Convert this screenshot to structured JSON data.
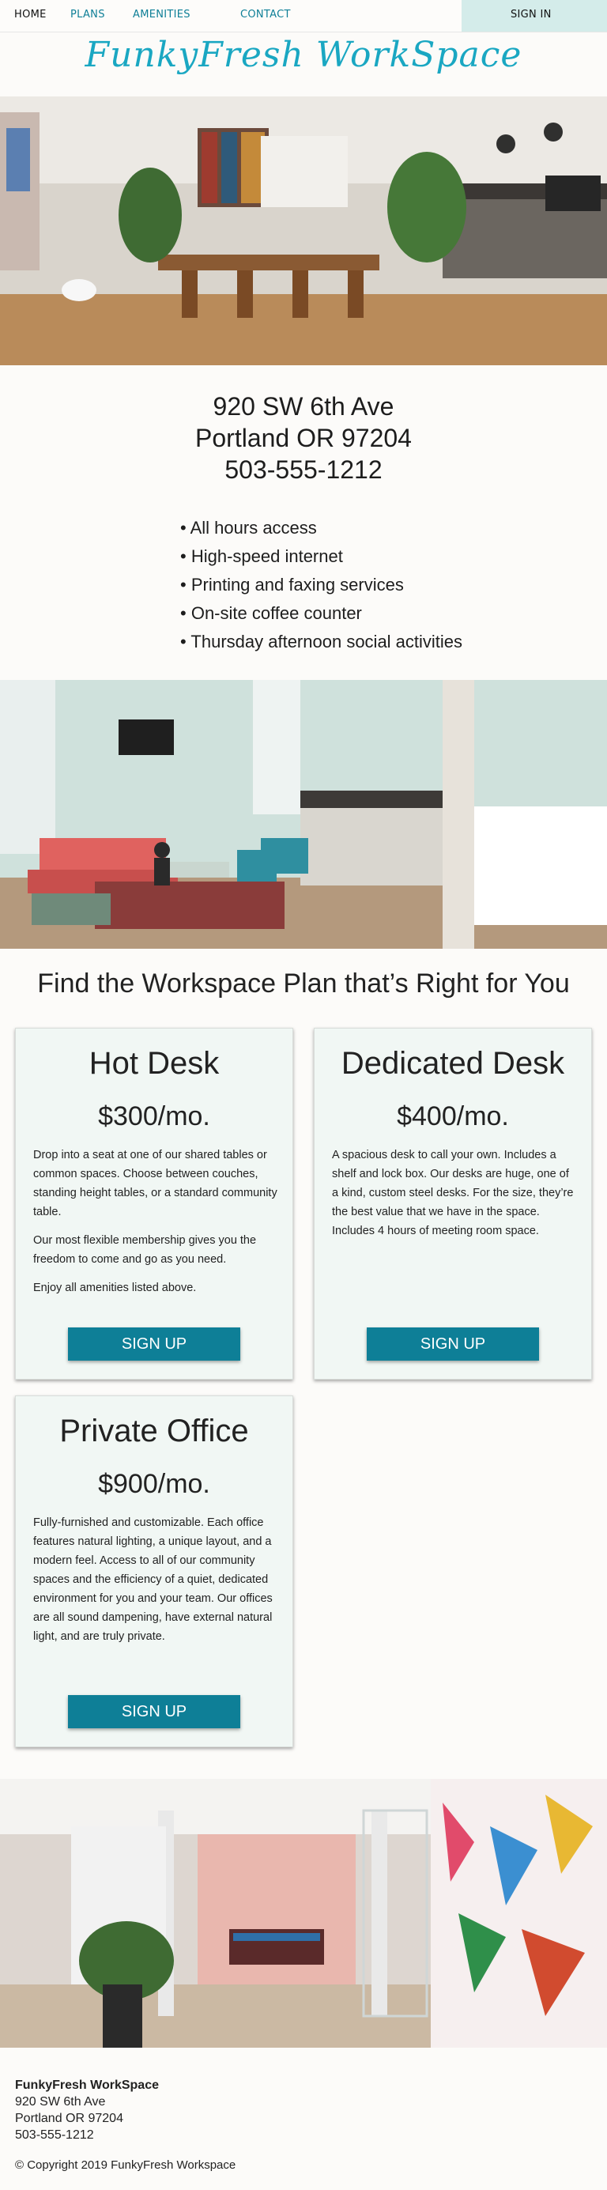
{
  "nav": {
    "home": "HOME",
    "plans": "PLANS",
    "amenities": "AMENITIES",
    "contact": "CONTACT",
    "sign_in": "SIGN IN"
  },
  "brand": {
    "name": "FunkyFresh WorkSpace"
  },
  "address": {
    "street": "920 SW 6th Ave",
    "city": "Portland OR 97204",
    "phone": "503-555-1212"
  },
  "features": [
    "All hours access",
    "High-speed internet",
    "Printing and faxing services",
    "On-site coffee counter",
    "Thursday afternoon social activities"
  ],
  "plans": {
    "heading": "Find the Workspace Plan that’s Right for You",
    "cards": [
      {
        "title": "Hot Desk",
        "price": "$300/mo.",
        "paragraphs": [
          "Drop into a seat at one of our shared tables or common spaces. Choose between couches, standing height tables, or a standard community table.",
          "Our most flexible membership gives you the freedom to come and go as you need.",
          "Enjoy all amenities listed above."
        ],
        "button": "SIGN UP"
      },
      {
        "title": "Dedicated Desk",
        "price": "$400/mo.",
        "paragraphs": [
          "A spacious desk to call your own. Includes a shelf and lock box. Our desks are huge, one of a kind, custom steel desks. For the size, they’re the best value that we have in the space. Includes 4 hours of meeting room space."
        ],
        "button": "SIGN UP"
      },
      {
        "title": "Private Office",
        "price": "$900/mo.",
        "paragraphs": [
          "Fully-furnished and customizable. Each office features natural lighting, a unique layout, and a modern feel. Access to all of our community spaces and the efficiency of a quiet, dedicated environment for you and your team. Our offices are all sound dampening, have external natural light, and are truly private."
        ],
        "button": "SIGN UP"
      }
    ]
  },
  "footer": {
    "name": "FunkyFresh WorkSpace",
    "street": "920 SW 6th Ave",
    "city": "Portland OR 97204",
    "phone": "503-555-1212",
    "copyright": "© Copyright 2019 FunkyFresh Workspace"
  },
  "colors": {
    "accent": "#0e7f97",
    "brand": "#1aa7c2",
    "card_bg": "#f1f7f4",
    "nav_signin_bg": "#d4ecea"
  }
}
